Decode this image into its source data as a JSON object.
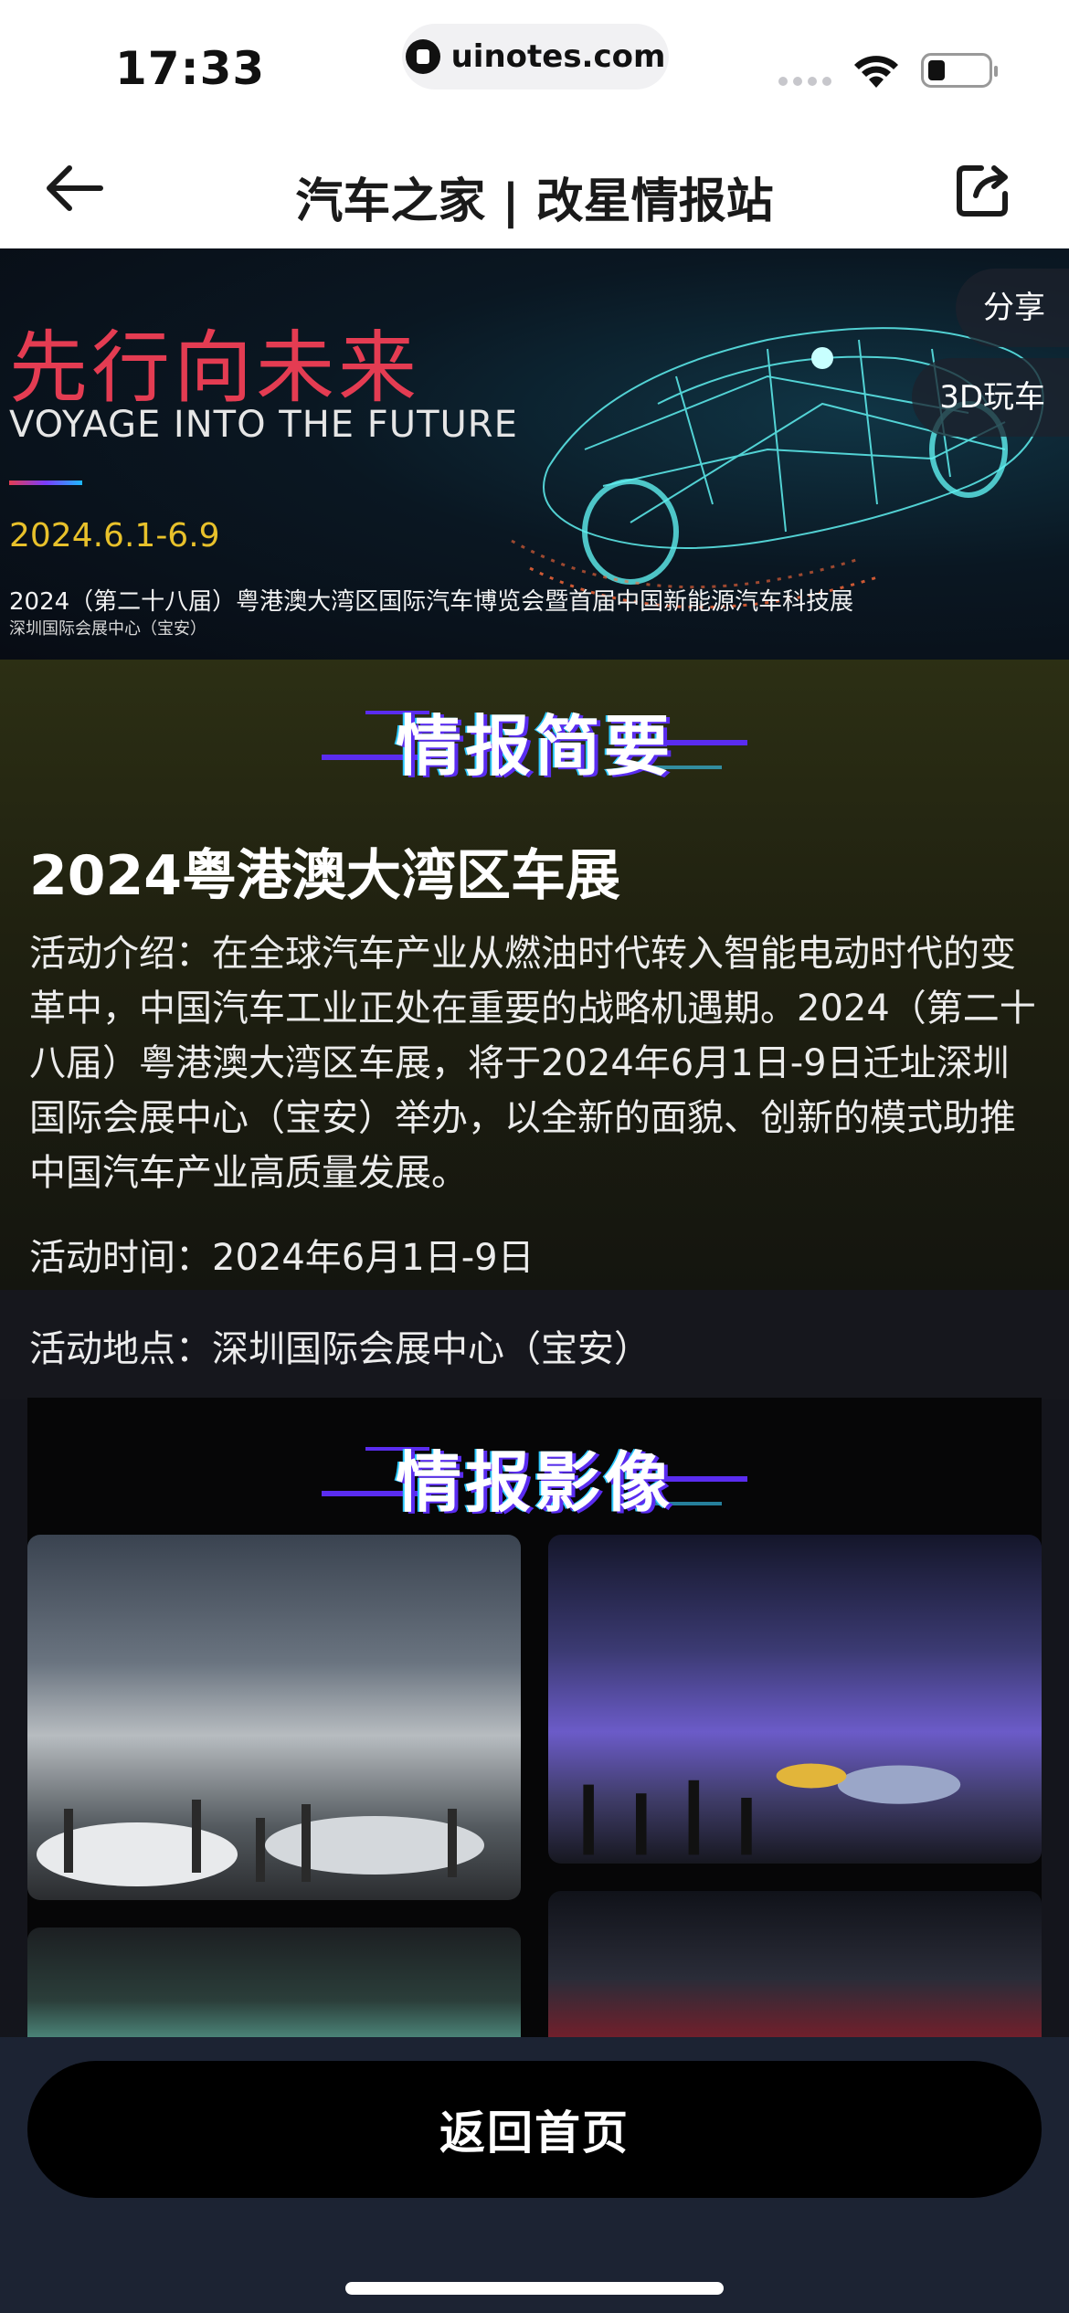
{
  "status_bar": {
    "time": "17:33",
    "url": "uinotes.com"
  },
  "nav": {
    "title": "汽车之家 | 改星情报站",
    "back_icon": "arrow-left-icon",
    "share_icon": "share-export-icon"
  },
  "banner": {
    "slogan": "先行向未来",
    "slogan_en": "VOYAGE INTO THE FUTURE",
    "date": "2024.6.1-6.9",
    "event_line": "2024（第二十八届）粤港澳大湾区国际汽车博览会暨首届中国新能源汽车科技展",
    "venue_line": "深圳国际会展中心（宝安）",
    "share_label": "分享",
    "play3d_label": "3D玩车"
  },
  "summary": {
    "section_title": "情报简要",
    "event_title": "2024粤港澳大湾区车展",
    "intro": "活动介绍：在全球汽车产业从燃油时代转入智能电动时代的变革中，中国汽车工业正处在重要的战略机遇期。2024（第二十八届）粤港澳大湾区车展，将于2024年6月1日-9日迁址深圳国际会展中心（宝安）举办，以全新的面貌、创新的模式助推中国汽车产业高质量发展。",
    "time": "活动时间：2024年6月1日-9日",
    "location": "活动地点：深圳国际会展中心（宝安）"
  },
  "gallery": {
    "section_title": "情报影像"
  },
  "footer": {
    "home_button": "返回首页"
  },
  "colors": {
    "accent_red": "#e43c52",
    "accent_purple": "#5a2cf0",
    "date_yellow": "#e8c12b",
    "bottom_bg": "#1c2333"
  }
}
